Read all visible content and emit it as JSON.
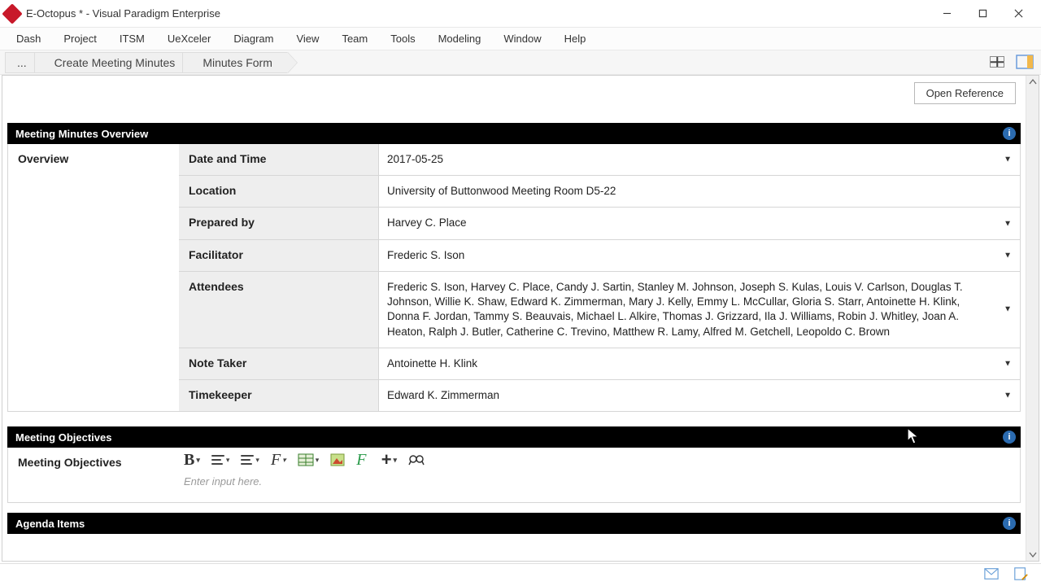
{
  "window": {
    "title": "E-Octopus * - Visual Paradigm Enterprise"
  },
  "menu": {
    "items": [
      "Dash",
      "Project",
      "ITSM",
      "UeXceler",
      "Diagram",
      "View",
      "Team",
      "Tools",
      "Modeling",
      "Window",
      "Help"
    ]
  },
  "breadcrumb": {
    "items": [
      "...",
      "Create Meeting Minutes",
      "Minutes Form"
    ]
  },
  "buttons": {
    "open_reference": "Open Reference"
  },
  "sections": {
    "overview": {
      "header": "Meeting Minutes Overview",
      "side_label": "Overview",
      "rows": {
        "date_label": "Date and Time",
        "date_value": "2017-05-25",
        "location_label": "Location",
        "location_value": "University of Buttonwood Meeting Room D5-22",
        "prepared_label": "Prepared by",
        "prepared_value": "Harvey C. Place",
        "facilitator_label": "Facilitator",
        "facilitator_value": "Frederic S. Ison",
        "attendees_label": "Attendees",
        "attendees_value": "Frederic S. Ison, Harvey C. Place, Candy J. Sartin, Stanley M. Johnson, Joseph S. Kulas, Louis V. Carlson, Douglas T. Johnson, Willie K. Shaw, Edward K. Zimmerman, Mary J. Kelly, Emmy L. McCullar, Gloria S. Starr, Antoinette H. Klink, Donna F. Jordan, Tammy S. Beauvais, Michael L. Alkire, Thomas J. Grizzard, Ila J. Williams, Robin J. Whitley, Joan A. Heaton, Ralph J. Butler, Catherine C. Trevino, Matthew R. Lamy, Alfred M. Getchell, Leopoldo C. Brown",
        "notetaker_label": "Note Taker",
        "notetaker_value": "Antoinette H. Klink",
        "timekeeper_label": "Timekeeper",
        "timekeeper_value": "Edward K. Zimmerman"
      }
    },
    "objectives": {
      "header": "Meeting Objectives",
      "side_label": "Meeting Objectives",
      "placeholder": "Enter input here."
    },
    "agenda": {
      "header": "Agenda Items"
    }
  }
}
